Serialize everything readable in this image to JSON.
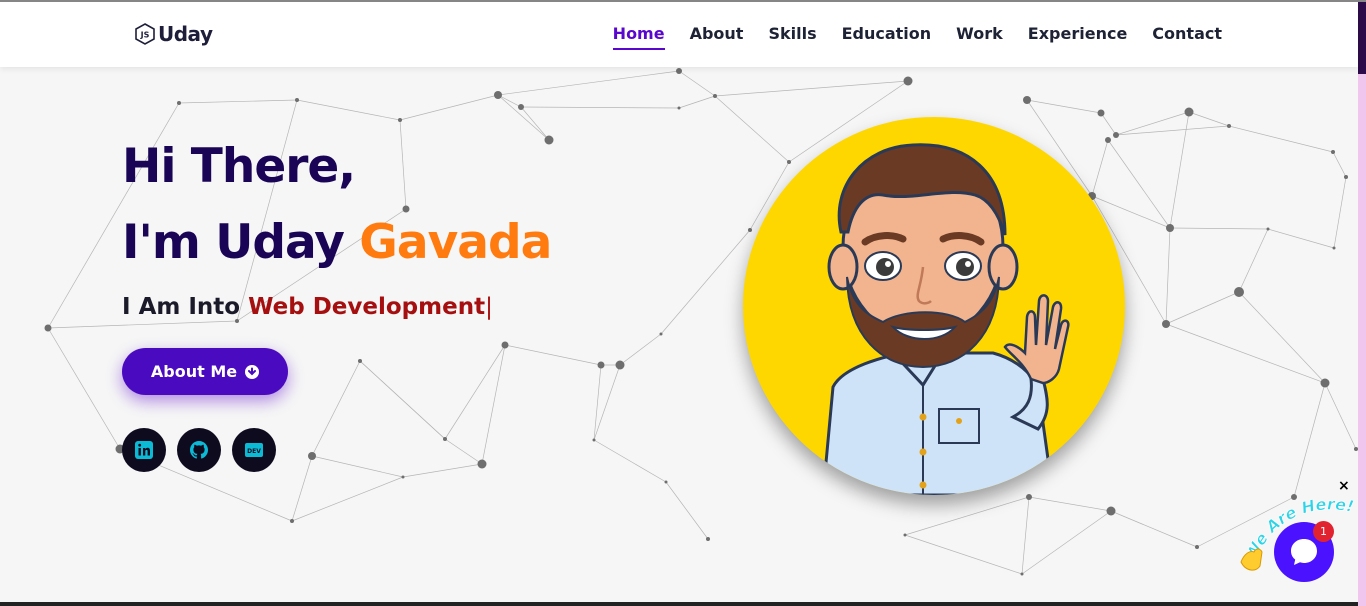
{
  "navbar": {
    "brand_icon": "js-hexagon-icon",
    "brand_name": "Uday",
    "links": [
      {
        "label": "Home",
        "active": true
      },
      {
        "label": "About"
      },
      {
        "label": "Skills"
      },
      {
        "label": "Education"
      },
      {
        "label": "Work"
      },
      {
        "label": "Experience"
      },
      {
        "label": "Contact"
      }
    ]
  },
  "hero": {
    "greeting": "Hi There,",
    "name_prefix": "I'm Uday ",
    "name_accent": "Gavada",
    "typed_prefix": "I Am Into ",
    "typed_value": "Web Development",
    "typed_cursor": "|",
    "about_button": "About Me",
    "about_button_icon": "arrow-down-circle-icon",
    "social_links": [
      {
        "icon": "linkedin-icon"
      },
      {
        "icon": "github-icon"
      },
      {
        "icon": "dev-icon"
      }
    ]
  },
  "avatar": {
    "icon": "bitmoji-avatar"
  },
  "chat_widget": {
    "label": "We Are Here!",
    "badge_count": "1",
    "close": "×"
  },
  "colors": {
    "heading": "#1a0456",
    "accent_orange": "#ff7b0f",
    "accent_red": "#a60f0f",
    "primary_purple": "#4a0ac0",
    "nav_active": "#5a07cd",
    "avatar_bg": "#ffd700",
    "chat_blue": "#4b12ff"
  }
}
